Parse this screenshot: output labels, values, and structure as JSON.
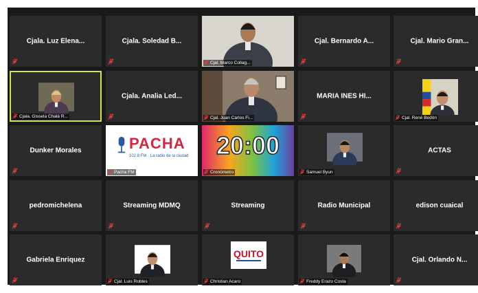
{
  "meeting": {
    "participants": [
      {
        "name": "Cjala. Luz Elena...",
        "muted": true
      },
      {
        "name": "Cjala. Soledad B...",
        "muted": true
      },
      {
        "name": "Cjal. Marco Collag...",
        "muted": true,
        "video": true
      },
      {
        "name": "Cjal. Bernardo A...",
        "muted": true
      },
      {
        "name": "Cjal. Mario Gran...",
        "muted": true
      },
      {
        "name": "Cjala. Gissela Chalá R...",
        "muted": true,
        "video": true,
        "active_speaker": true
      },
      {
        "name": "Cjala. Analia Led...",
        "muted": true
      },
      {
        "name": "Cjal. Juan Carlos Fi...",
        "muted": true,
        "video": true
      },
      {
        "name": "MARIA INES HI...",
        "muted": true
      },
      {
        "name": "Cjal. René Bedón",
        "muted": true,
        "video": true
      },
      {
        "name": "Dunker Morales",
        "muted": true
      },
      {
        "name": "Pacha FM",
        "muted": true,
        "video": true
      },
      {
        "name": "Cronómetro",
        "muted": true,
        "video": true
      },
      {
        "name": "Samuel Byun",
        "muted": true,
        "video": true
      },
      {
        "name": "ACTAS",
        "muted": true
      },
      {
        "name": "pedromichelena",
        "muted": true
      },
      {
        "name": "Streaming MDMQ",
        "muted": true
      },
      {
        "name": "Streaming",
        "muted": true
      },
      {
        "name": "Radio Municipal",
        "muted": true
      },
      {
        "name": "edison cuaical",
        "muted": true
      },
      {
        "name": "Gabriela Enriquez",
        "muted": true
      },
      {
        "name": "Cjal. Luis Robles",
        "muted": true,
        "video": true
      },
      {
        "name": "Christian Acaro",
        "muted": true,
        "video": true
      },
      {
        "name": "Freddy Erazo Costa",
        "muted": true,
        "video": true
      },
      {
        "name": "Cjal. Orlando N...",
        "muted": true
      }
    ],
    "pacha_logo": {
      "brand": "PACHA",
      "frequency": "102.8 FM",
      "tagline": "La radio de la ciudad"
    },
    "countdown_timer": "20:00",
    "quito_logo": "QUITO",
    "colors": {
      "grid": "#1a1a1a",
      "tile": "#2b2b2b",
      "active_border": "#d6e34a",
      "mute": "#e0403a"
    }
  }
}
